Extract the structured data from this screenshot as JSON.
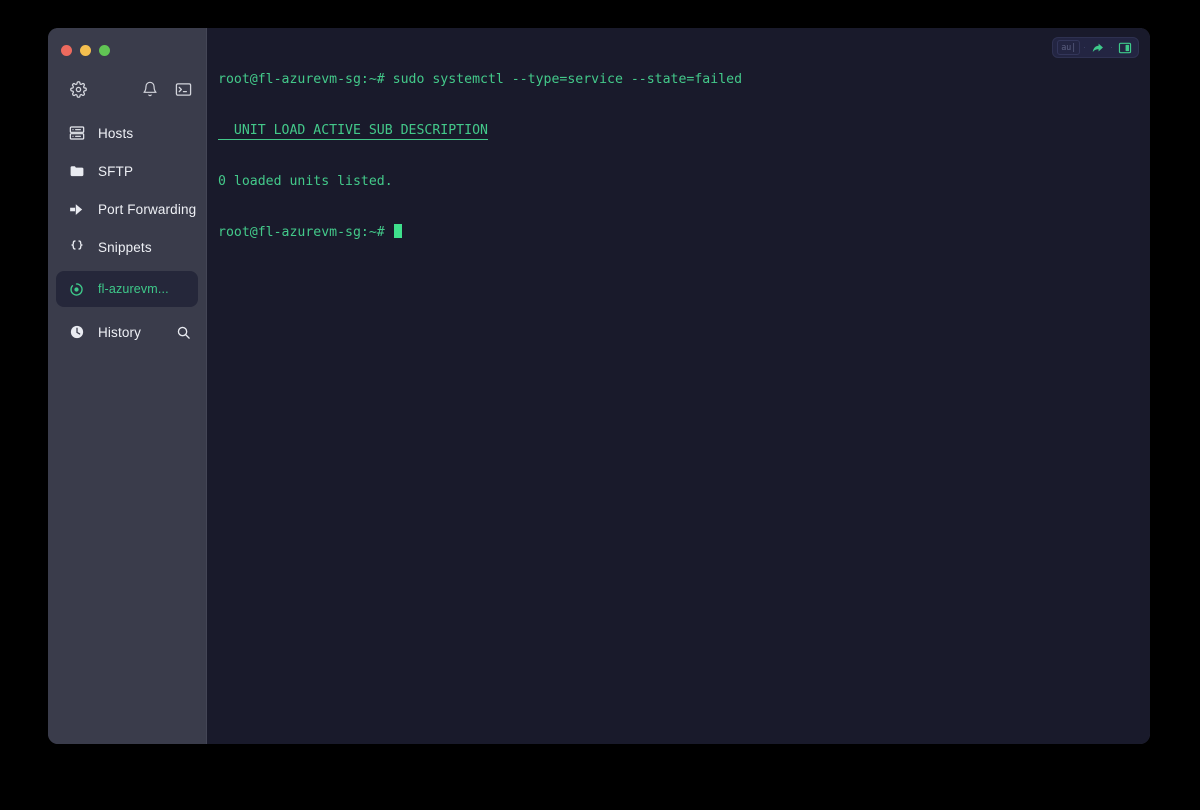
{
  "window": {
    "traffic_lights": [
      {
        "name": "close",
        "color": "#ed6a5e"
      },
      {
        "name": "minimize",
        "color": "#f4bf4f"
      },
      {
        "name": "maximize",
        "color": "#61c554"
      }
    ]
  },
  "sidebar": {
    "top_icons": [
      {
        "name": "gear-icon",
        "label": "Settings"
      },
      {
        "name": "bell-icon",
        "label": "Notifications"
      },
      {
        "name": "terminal-icon",
        "label": "Terminal"
      }
    ],
    "items": [
      {
        "label": "Hosts",
        "icon": "server-icon"
      },
      {
        "label": "SFTP",
        "icon": "folder-icon"
      },
      {
        "label": "Port Forwarding",
        "icon": "arrow-right-icon"
      },
      {
        "label": "Snippets",
        "icon": "braces-icon"
      }
    ],
    "session": {
      "label": "fl-azurevm...",
      "icon": "session-active-icon",
      "color": "#3ec98a"
    },
    "history": {
      "label": "History",
      "icon": "clock-icon",
      "search_icon": "search-icon"
    }
  },
  "terminal": {
    "controls": {
      "au_label": "au|",
      "separator": "·",
      "arrow_icon": "share-arrow-icon",
      "split_icon": "split-pane-icon"
    },
    "lines": [
      {
        "text": "root@fl-azurevm-sg:~# sudo systemctl --type=service --state=failed",
        "style": "normal"
      },
      {
        "text": "  UNIT LOAD ACTIVE SUB DESCRIPTION",
        "style": "header"
      },
      {
        "text": "0 loaded units listed.",
        "style": "normal"
      }
    ],
    "prompt": "root@fl-azurevm-sg:~# "
  },
  "colors": {
    "page_background": "#000000",
    "sidebar_background": "#3a3c4b",
    "terminal_background": "#191a2b",
    "accent_green": "#3ec98a",
    "cursor_green": "#3fe08c",
    "session_active_background": "#25273a"
  }
}
